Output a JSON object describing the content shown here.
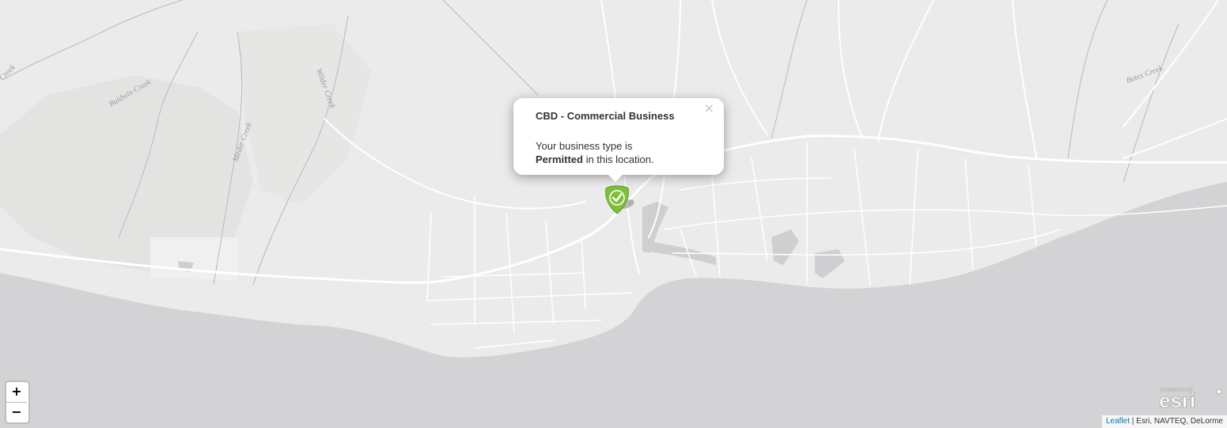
{
  "map": {
    "labels": {
      "creek_far_left": "Creek",
      "baldwin": "Baldwin Creek",
      "meder": "Meder Creek",
      "wilder": "Wilder Creek",
      "bates": "Bates Creek"
    },
    "colors": {
      "land": "#ebebeb",
      "water": "#d3d3d6",
      "parkland": "#e4e5e3",
      "roads": "#ffffff",
      "marker": "#7fbf3a"
    }
  },
  "popup": {
    "title": "CBD - Commercial Business",
    "body_prefix": "Your business type is",
    "status": "Permitted",
    "body_suffix": " in this location.",
    "close_glyph": "×"
  },
  "marker": {
    "icon": "check-icon"
  },
  "zoom": {
    "in_label": "+",
    "out_label": "−"
  },
  "logo": {
    "powered_by": "POWERED BY",
    "name": "esri"
  },
  "attribution": {
    "leaflet": "Leaflet",
    "separator": " | ",
    "sources": "Esri, NAVTEQ, DeLorme"
  }
}
